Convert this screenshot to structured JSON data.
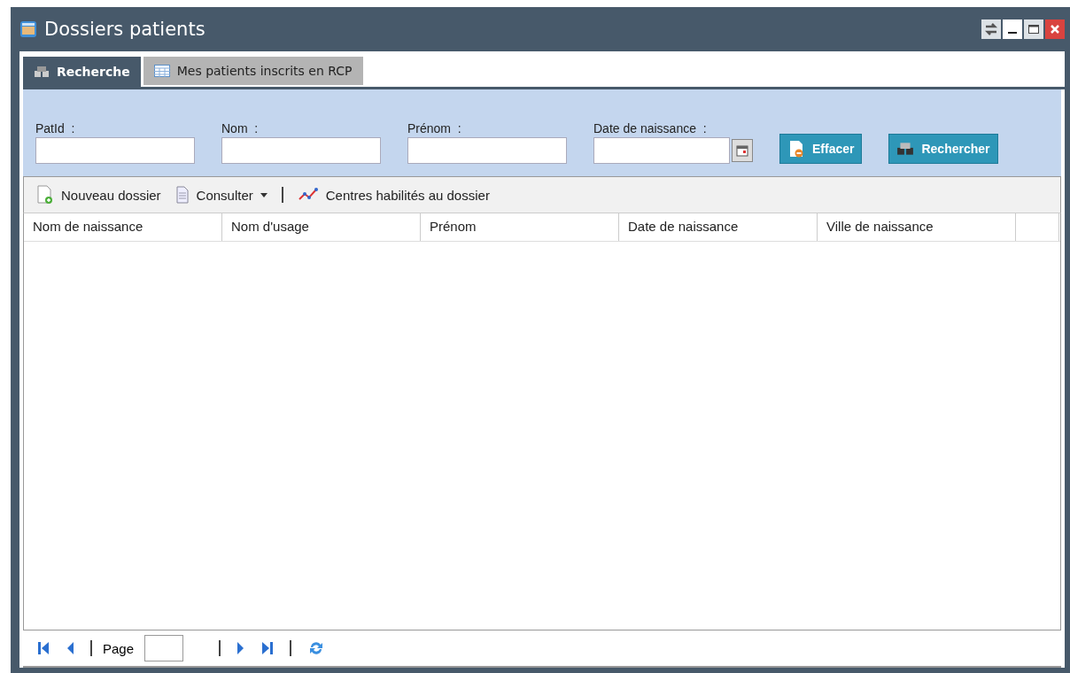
{
  "window": {
    "title": "Dossiers patients"
  },
  "tabs": [
    {
      "label": "Recherche",
      "selected": true
    },
    {
      "label": "Mes patients inscrits en RCP",
      "selected": false
    }
  ],
  "search_form": {
    "fields": [
      {
        "label": "PatId",
        "separator": ":",
        "kind": "text"
      },
      {
        "label": "Nom",
        "separator": ":",
        "kind": "text"
      },
      {
        "label": "Prénom",
        "separator": ":",
        "kind": "text"
      },
      {
        "label": "Date de naissance",
        "separator": ":",
        "kind": "date"
      }
    ],
    "buttons": [
      "Effacer",
      "Rechercher"
    ]
  },
  "toolbar": [
    {
      "label": "Nouveau dossier",
      "kind": "new"
    },
    {
      "label": "Consulter",
      "kind": "dropdown"
    },
    {
      "kind": "separator"
    },
    {
      "label": "Centres habilités au dossier",
      "kind": "chart"
    }
  ],
  "table": {
    "columns": [
      "Nom de naissance",
      "Nom d'usage",
      "Prénom",
      "Date de naissance",
      "Ville de naissance"
    ]
  },
  "pager": {
    "label": "Page"
  }
}
